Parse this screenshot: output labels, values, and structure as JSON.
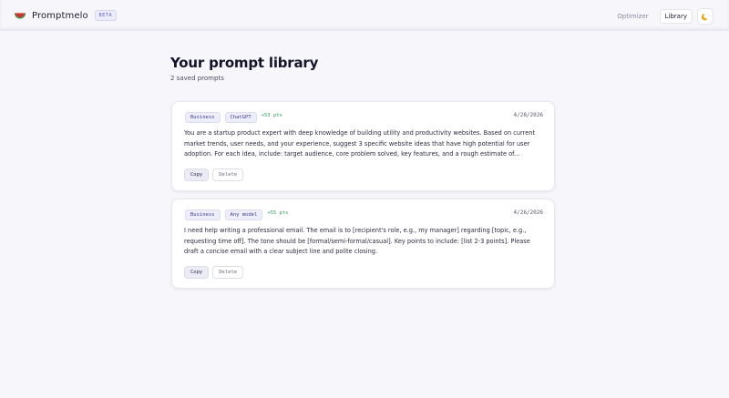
{
  "app": {
    "name": "Promptmelo",
    "badge": "BETA"
  },
  "nav": {
    "optimizer": "Optimizer",
    "library": "Library",
    "theme_icon": "moon-icon"
  },
  "page": {
    "title": "Your prompt library",
    "count_text": "2 saved prompts"
  },
  "prompts": [
    {
      "category": "Business",
      "model": "ChatGPT",
      "points": "+53 pts",
      "date": "4/28/2026",
      "text": "You are a startup product expert with deep knowledge of building utility and productivity websites. Based on current market trends, user needs, and your experience, suggest 3 specific website ideas that have high potential for user adoption. For each idea, include: target audience, core problem solved, key features, and a rough estimate of...",
      "copy_label": "Copy",
      "delete_label": "Delete"
    },
    {
      "category": "Business",
      "model": "Any model",
      "points": "+55 pts",
      "date": "4/26/2026",
      "text": "I need help writing a professional email. The email is to [recipient's role, e.g., my manager] regarding [topic, e.g., requesting time off]. The tone should be [formal/semi-formal/casual]. Key points to include: [list 2-3 points]. Please draft a concise email with a clear subject line and polite closing.",
      "copy_label": "Copy",
      "delete_label": "Delete"
    }
  ]
}
